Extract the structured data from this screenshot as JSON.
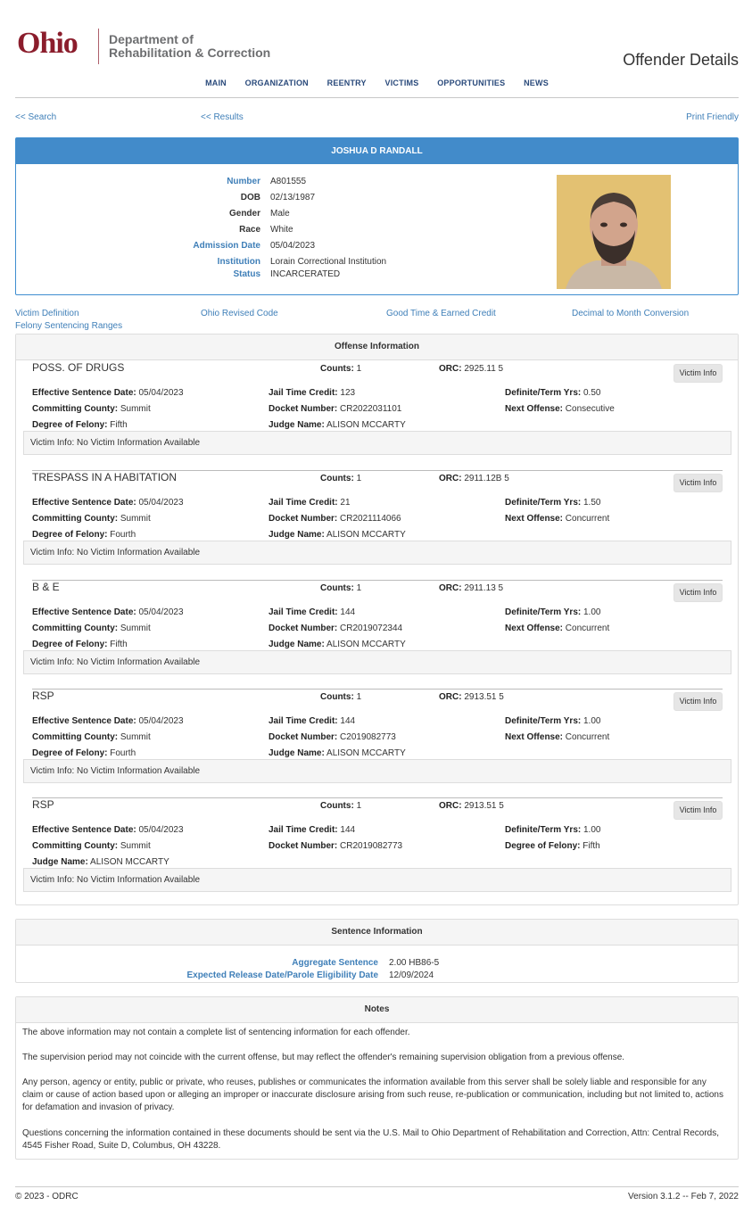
{
  "header": {
    "logo_ohio": "Ohio",
    "dept_line1": "Department of",
    "dept_line2": "Rehabilitation & Correction",
    "page_title": "Offender Details",
    "nav": [
      "MAIN",
      "ORGANIZATION",
      "REENTRY",
      "VICTIMS",
      "OPPORTUNITIES",
      "NEWS"
    ]
  },
  "toplinks": {
    "search": "<< Search",
    "results": "<< Results",
    "print": "Print Friendly"
  },
  "offender": {
    "name": "JOSHUA D RANDALL",
    "fields": [
      {
        "label": "Number",
        "value": "A801555",
        "blue": true
      },
      {
        "label": "DOB",
        "value": "02/13/1987",
        "blue": false
      },
      {
        "label": "Gender",
        "value": "Male",
        "blue": false
      },
      {
        "label": "Race",
        "value": "White",
        "blue": false
      },
      {
        "label": "Admission Date",
        "value": "05/04/2023",
        "blue": true
      },
      {
        "label": "Institution",
        "value": "Lorain Correctional Institution",
        "blue": true
      },
      {
        "label": "Status",
        "value": "INCARCERATED",
        "blue": true
      }
    ]
  },
  "reflinks": [
    "Victim Definition",
    "Ohio Revised Code",
    "Good Time & Earned Credit",
    "Decimal to Month Conversion",
    "Felony Sentencing Ranges"
  ],
  "offense_section": {
    "title": "Offense Information",
    "victim_button": "Victim Info",
    "offenses": [
      {
        "title": "POSS. OF DRUGS",
        "counts": "1",
        "orc": "2925.11 5",
        "rows": [
          [
            [
              "Effective Sentence Date:",
              "05/04/2023"
            ],
            [
              "Jail Time Credit:",
              "123"
            ],
            [
              "Definite/Term Yrs:",
              "0.50"
            ]
          ],
          [
            [
              "Committing County:",
              "Summit"
            ],
            [
              "Docket Number:",
              "CR2022031101"
            ],
            [
              "Next Offense:",
              "Consecutive"
            ]
          ],
          [
            [
              "Degree of Felony:",
              "Fifth"
            ],
            [
              "Judge Name:",
              "ALISON MCCARTY"
            ],
            null
          ]
        ],
        "victim_info": "Victim Info: No Victim Information Available"
      },
      {
        "title": "TRESPASS IN A HABITATION",
        "counts": "1",
        "orc": "2911.12B 5",
        "rows": [
          [
            [
              "Effective Sentence Date:",
              "05/04/2023"
            ],
            [
              "Jail Time Credit:",
              "21"
            ],
            [
              "Definite/Term Yrs:",
              "1.50"
            ]
          ],
          [
            [
              "Committing County:",
              "Summit"
            ],
            [
              "Docket Number:",
              "CR2021114066"
            ],
            [
              "Next Offense:",
              "Concurrent"
            ]
          ],
          [
            [
              "Degree of Felony:",
              "Fourth"
            ],
            [
              "Judge Name:",
              "ALISON MCCARTY"
            ],
            null
          ]
        ],
        "victim_info": "Victim Info: No Victim Information Available"
      },
      {
        "title": "B & E",
        "counts": "1",
        "orc": "2911.13 5",
        "rows": [
          [
            [
              "Effective Sentence Date:",
              "05/04/2023"
            ],
            [
              "Jail Time Credit:",
              "144"
            ],
            [
              "Definite/Term Yrs:",
              "1.00"
            ]
          ],
          [
            [
              "Committing County:",
              "Summit"
            ],
            [
              "Docket Number:",
              "CR2019072344"
            ],
            [
              "Next Offense:",
              "Concurrent"
            ]
          ],
          [
            [
              "Degree of Felony:",
              "Fifth"
            ],
            [
              "Judge Name:",
              "ALISON MCCARTY"
            ],
            null
          ]
        ],
        "victim_info": "Victim Info: No Victim Information Available"
      },
      {
        "title": "RSP",
        "counts": "1",
        "orc": "2913.51 5",
        "rows": [
          [
            [
              "Effective Sentence Date:",
              "05/04/2023"
            ],
            [
              "Jail Time Credit:",
              "144"
            ],
            [
              "Definite/Term Yrs:",
              "1.00"
            ]
          ],
          [
            [
              "Committing County:",
              "Summit"
            ],
            [
              "Docket Number:",
              "C2019082773"
            ],
            [
              "Next Offense:",
              "Concurrent"
            ]
          ],
          [
            [
              "Degree of Felony:",
              "Fourth"
            ],
            [
              "Judge Name:",
              "ALISON MCCARTY"
            ],
            null
          ]
        ],
        "victim_info": "Victim Info: No Victim Information Available"
      },
      {
        "title": "RSP",
        "counts": "1",
        "orc": "2913.51 5",
        "rows": [
          [
            [
              "Effective Sentence Date:",
              "05/04/2023"
            ],
            [
              "Jail Time Credit:",
              "144"
            ],
            [
              "Definite/Term Yrs:",
              "1.00"
            ]
          ],
          [
            [
              "Committing County:",
              "Summit"
            ],
            [
              "Docket Number:",
              "CR2019082773"
            ],
            [
              "Degree of Felony:",
              "Fifth"
            ]
          ],
          [
            [
              "Judge Name:",
              "ALISON MCCARTY"
            ],
            null,
            null
          ]
        ],
        "victim_info": "Victim Info: No Victim Information Available"
      }
    ]
  },
  "sentence": {
    "title": "Sentence Information",
    "aggregate_label": "Aggregate Sentence",
    "aggregate_value": "2.00 HB86-5",
    "release_label": "Expected Release Date/Parole Eligibility Date",
    "release_value": "12/09/2024"
  },
  "notes": {
    "title": "Notes",
    "paragraphs": [
      "The above information may not contain a complete list of sentencing information for each offender.",
      "The supervision period may not coincide with the current offense, but may reflect the offender's remaining supervision obligation from a previous offense.",
      "Any person, agency or entity, public or private, who reuses, publishes or communicates the information available from this server shall be solely liable and responsible for any claim or cause of action based upon or alleging an improper or inaccurate disclosure arising from such reuse, re-publication or communication, including but not limited to, actions for defamation and invasion of privacy.",
      "Questions concerning the information contained in these documents should be sent via the U.S. Mail to Ohio Department of Rehabilitation and Correction, Attn: Central Records, 4545 Fisher Road, Suite D, Columbus, OH 43228."
    ]
  },
  "footer": {
    "copyright": "© 2023 - ODRC",
    "version": "Version 3.1.2 -- Feb 7, 2022"
  },
  "colors": {
    "primary_blue": "#428bca",
    "link_blue": "#3f7fb8",
    "ohio_red": "#8b1d2c"
  }
}
